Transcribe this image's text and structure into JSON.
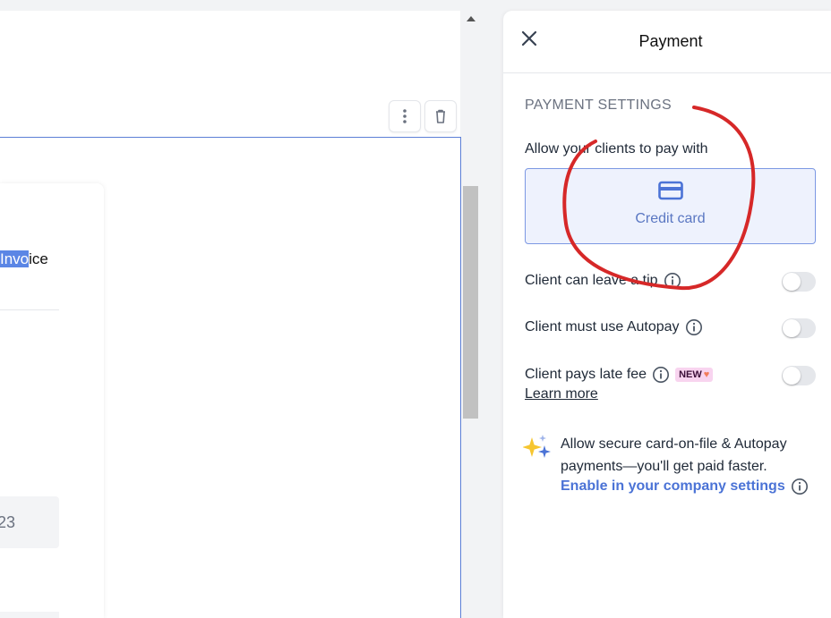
{
  "editor": {
    "invoice_title_selected": "Invo",
    "invoice_title_rest": "ice",
    "number_field_value": "23"
  },
  "panel": {
    "title": "Payment",
    "section_title": "PAYMENT SETTINGS",
    "allow_label": "Allow your clients to pay with",
    "credit_card_label": "Credit card",
    "tip_label": "Client can leave a tip",
    "autopay_label": "Client must use Autopay",
    "late_fee_label": "Client pays late fee",
    "new_badge": "NEW",
    "learn_more": "Learn more",
    "promo_text": "Allow secure card-on-file & Autopay payments—you'll get paid faster.",
    "promo_link": "Enable in your company settings"
  },
  "toggles": {
    "tip_enabled": false,
    "autopay_enabled": false,
    "late_fee_enabled": false
  },
  "colors": {
    "accent": "#5a77c2",
    "link": "#4b73d6",
    "annotation": "#d62828",
    "selection": "#5b86e5"
  }
}
